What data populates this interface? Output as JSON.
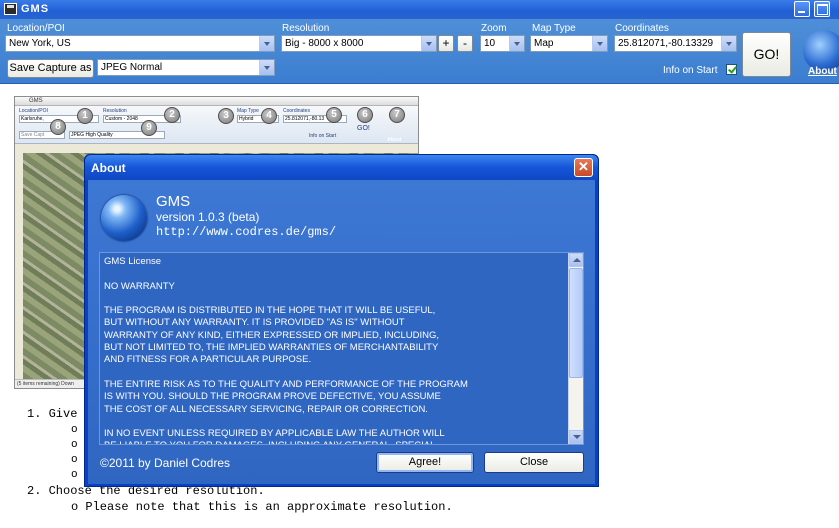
{
  "window": {
    "title": "GMS"
  },
  "toolbar": {
    "location_label": "Location/POI",
    "location_value": "New York, US",
    "resolution_label": "Resolution",
    "resolution_value": "Big - 8000 x 8000",
    "plus": "+",
    "minus": "-",
    "zoom_label": "Zoom",
    "zoom_value": "10",
    "maptype_label": "Map Type",
    "maptype_value": "Map",
    "coords_label": "Coordinates",
    "coords_value": "25.812071,-80.13329",
    "go_label": "GO!",
    "save_capture_label": "Save Capture as",
    "format_value": "JPEG Normal",
    "info_on_start_label": "Info on Start",
    "about_label": "About"
  },
  "screenshot_preview": {
    "title": "GMS",
    "location_label": "Location/POI",
    "location_value": "Karlsruhe,",
    "resolution_label": "Resolution",
    "resolution_value": "Custom - 2048",
    "maptype_label": "Map Type",
    "maptype_value": "Hybrid",
    "coords_label": "Coordinates",
    "coords_value": "25.812071,-80.13",
    "go_label": "GO!",
    "save_label": "Save Capt",
    "format_value": "JPEG High Quality",
    "info_label": "Info on Start",
    "about_label": "About",
    "status": "(5 items remaining) Down",
    "markers": [
      "1",
      "2",
      "3",
      "4",
      "5",
      "6",
      "7",
      "8",
      "9"
    ]
  },
  "doc": {
    "step1": "1. Give",
    "step1_bullets": [
      "o",
      "o",
      "o",
      "o"
    ],
    "step2": "2. Choose the desired resolution.",
    "step2_note": "o Please note that this is an approximate resolution."
  },
  "about_dialog": {
    "title": "About",
    "close": "✕",
    "app_name": "GMS",
    "version": "version 1.0.3 (beta)",
    "url": "http://www.codres.de/gms/",
    "license_text": "GMS License\n\nNO WARRANTY\n\nTHE PROGRAM IS DISTRIBUTED IN THE HOPE THAT IT WILL BE USEFUL,\nBUT WITHOUT ANY WARRANTY. IT IS PROVIDED \"AS IS\" WITHOUT\nWARRANTY OF ANY KIND, EITHER EXPRESSED OR IMPLIED, INCLUDING,\nBUT NOT LIMITED TO, THE IMPLIED WARRANTIES OF MERCHANTABILITY\nAND FITNESS FOR A PARTICULAR PURPOSE.\n\nTHE ENTIRE RISK AS TO THE QUALITY AND PERFORMANCE OF THE PROGRAM\nIS WITH YOU. SHOULD THE PROGRAM PROVE DEFECTIVE, YOU ASSUME\nTHE COST OF ALL NECESSARY SERVICING, REPAIR OR CORRECTION.\n\nIN NO EVENT UNLESS REQUIRED BY APPLICABLE LAW THE AUTHOR WILL\nBE LIABLE TO YOU FOR DAMAGES, INCLUDING ANY GENERAL, SPECIAL,",
    "copyright": "©2011 by Daniel Codres",
    "agree_label": "Agree!",
    "close_label": "Close"
  }
}
